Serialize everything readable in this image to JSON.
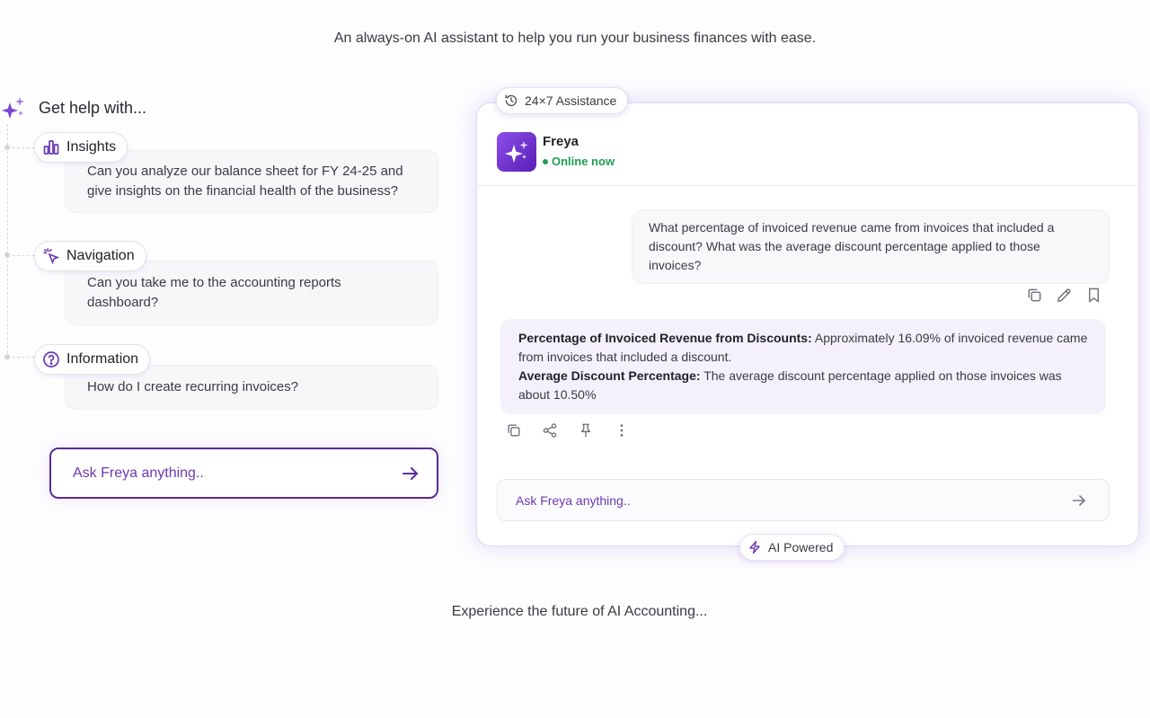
{
  "tagline": "An always-on AI assistant to help you run your business finances with ease.",
  "footer": "Experience the future of AI Accounting...",
  "help": {
    "heading": "Get help with...",
    "items": [
      {
        "label": "Insights",
        "icon": "bar-chart-icon",
        "prompt": "Can you analyze our balance sheet for FY 24-25 and give insights on the financial health of the business?"
      },
      {
        "label": "Navigation",
        "icon": "cursor-click-icon",
        "prompt": "Can you take me to the accounting reports dashboard?"
      },
      {
        "label": "Information",
        "icon": "question-circle-icon",
        "prompt": "How do I create recurring invoices?"
      }
    ],
    "ask_placeholder": "Ask Freya anything.."
  },
  "chat": {
    "top_badge": "24×7 Assistance",
    "bottom_badge": "AI Powered",
    "agent_name": "Freya",
    "agent_status": "Online now",
    "user_message": "What percentage of invoiced revenue came from invoices that included a discount? What was the average discount percentage applied to those invoices?",
    "bot_message": {
      "line1_label": "Percentage of Invoiced Revenue from Discounts:",
      "line1_text": " Approximately 16.09% of invoiced revenue came from invoices that included a discount.",
      "line2_label": "Average Discount Percentage:",
      "line2_text": " The average discount percentage applied on those invoices was about 10.50%"
    },
    "input_placeholder": "Ask Freya anything.."
  },
  "colors": {
    "accent": "#5b2b9a",
    "accent_text": "#6a3ab0",
    "online": "#1f9d55",
    "bot_bubble": "#f5f1fb"
  }
}
